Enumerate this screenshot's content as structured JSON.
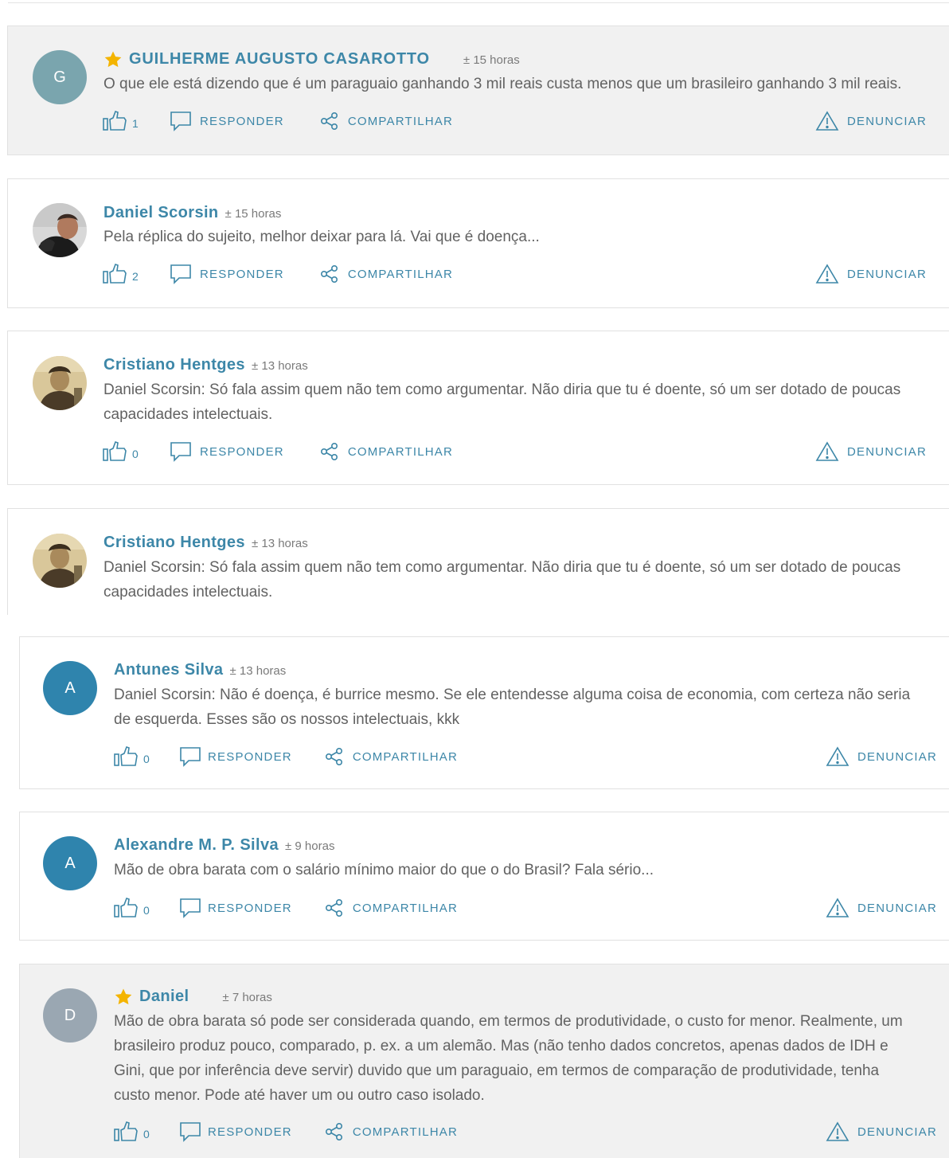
{
  "actions": {
    "reply": "RESPONDER",
    "share": "COMPARTILHAR",
    "report": "DENUNCIAR"
  },
  "colors": {
    "accent": "#3d87a8",
    "highlight_bg": "#f1f1f1",
    "star": "#f4b400"
  },
  "comments": [
    {
      "initial": "G",
      "author": "GUILHERME AUGUSTO CASAROTTO",
      "time": "± 15 horas",
      "starred": true,
      "text": "O que ele está dizendo que é um paraguaio ganhando 3 mil reais custa menos que um brasileiro ganhando 3 mil reais.",
      "likes": "1"
    },
    {
      "author": "Daniel Scorsin",
      "time": "± 15 horas",
      "text": "Pela réplica do sujeito, melhor deixar para lá. Vai que é doença...",
      "likes": "2"
    },
    {
      "author": "Cristiano Hentges",
      "time": "± 13 horas",
      "text": "Daniel Scorsin: Só fala assim quem não tem como argumentar. Não diria que tu é doente, só um ser dotado de poucas\ncapacidades intelectuais.",
      "likes": "0"
    },
    {
      "author": "Cristiano Hentges",
      "time": "± 13 horas",
      "text": "Daniel Scorsin: Só fala assim quem não tem como argumentar. Não diria que tu é doente, só um ser dotado de poucas\ncapacidades intelectuais."
    },
    {
      "initial": "A",
      "author": "Antunes Silva",
      "time": "± 13 horas",
      "text": "Daniel Scorsin: Não é doença, é burrice mesmo. Se ele entendesse alguma coisa de economia, com certeza não seria\nde esquerda. Esses são os nossos intelectuais, kkk",
      "likes": "0"
    },
    {
      "initial": "A",
      "author": "Alexandre M. P. Silva",
      "time": "± 9 horas",
      "text": "Mão de obra barata com o salário mínimo maior do que o do Brasil? Fala sério...",
      "likes": "0"
    },
    {
      "initial": "D",
      "author": "Daniel",
      "time": "± 7 horas",
      "starred": true,
      "text": "Mão de obra barata só pode ser considerada quando, em termos de produtividade, o custo for menor. Realmente, um\nbrasileiro produz pouco, comparado, p. ex. a um alemão. Mas (não tenho dados concretos, apenas dados de IDH e\nGini, que por inferência deve servir) duvido que um paraguaio, em termos de comparação de produtividade, tenha\ncusto menor. Pode até haver um ou outro caso isolado.",
      "likes": "0"
    }
  ]
}
